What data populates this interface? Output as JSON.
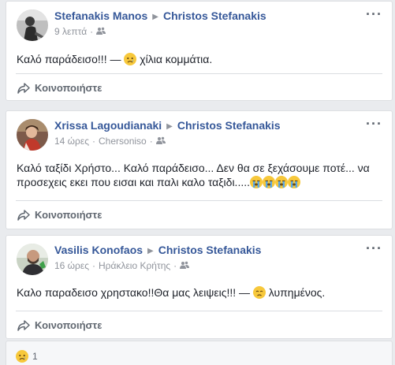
{
  "posts": [
    {
      "author": "Stefanakis Manos",
      "target": "Christos Stefanakis",
      "time": "9 λεπτά",
      "location": "",
      "text_before": "Καλό παράδεισο!!! — ",
      "text_after": " χίλια κομμάτια.",
      "emoji_icons": [
        "sad-face-emoji"
      ],
      "share_label": "Κοινοποιήστε"
    },
    {
      "author": "Xrissa Lagoudianaki",
      "target": "Christos Stefanakis",
      "time": "14 ώρες",
      "location": "Chersoniso",
      "text_line1": "Καλό ταξίδι Χρήστο... Καλό παράδεισο... Δεν θα σε ξεχάσουμε ποτέ... να",
      "text_line2": "προσεχεις εκει που εισαι και παλι καλο ταξιδι.....",
      "emoji_icons": [
        "crying-face-emoji",
        "crying-face-emoji",
        "crying-face-emoji",
        "crying-face-emoji"
      ],
      "share_label": "Κοινοποιήστε"
    },
    {
      "author": "Vasilis Konofaos",
      "target": "Christos Stefanakis",
      "time": "16 ώρες",
      "location": "Ηράκλειο Κρήτης",
      "text_before": "Καλο παραδεισο χρηστακο!!Θα μας λειψεις!!! — ",
      "text_after": " λυπημένος.",
      "emoji_icons": [
        "sad-face-emoji"
      ],
      "share_label": "Κοινοποιήστε"
    }
  ],
  "reactions": {
    "icon": "sad-reaction-icon",
    "count": "1"
  },
  "colors": {
    "link": "#365899",
    "meta": "#90949c",
    "emoji": "#f7c83b"
  }
}
